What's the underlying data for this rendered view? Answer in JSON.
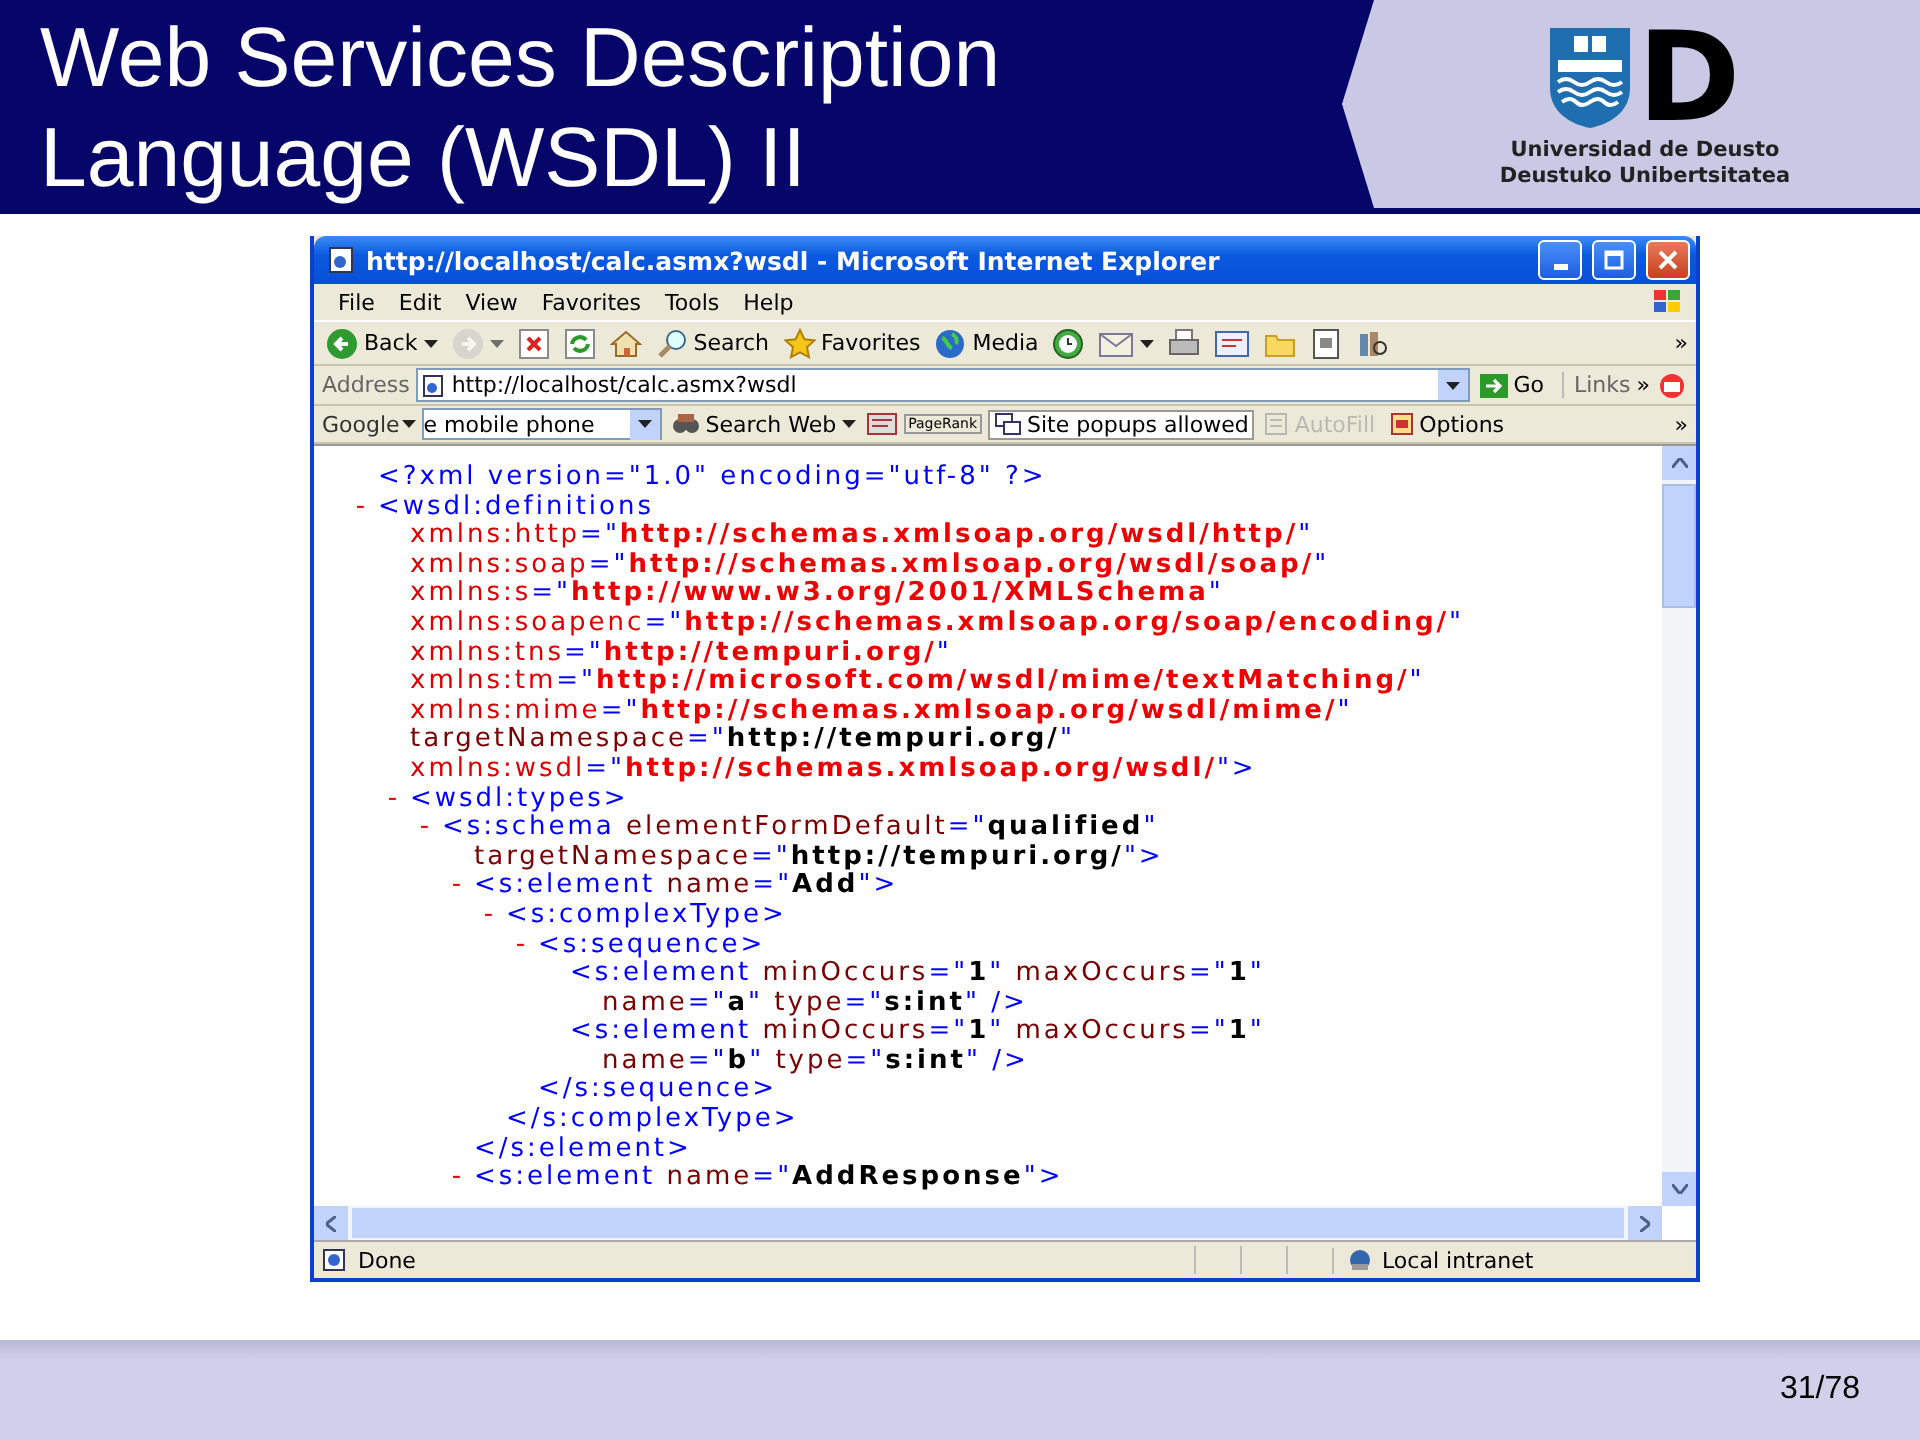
{
  "slide": {
    "title_lines": [
      "Web Services Description",
      "Language (WSDL) II"
    ],
    "logo": {
      "letter": "D",
      "name_lines": [
        "Universidad de Deusto",
        "Deustuko Unibertsitatea"
      ]
    },
    "page_number": "31/78"
  },
  "browser": {
    "title": "http://localhost/calc.asmx?wsdl - Microsoft Internet Explorer",
    "menu": [
      "File",
      "Edit",
      "View",
      "Favorites",
      "Tools",
      "Help"
    ],
    "toolbar": [
      {
        "label": "Back",
        "dropdown": true,
        "disabled": false
      },
      {
        "dropdown": true,
        "disabled": true
      },
      {
        "dropdown": false,
        "disabled": false
      },
      {
        "dropdown": false,
        "disabled": false
      },
      {
        "dropdown": false,
        "disabled": false
      },
      {
        "label": "Search",
        "dropdown": false,
        "disabled": false
      },
      {
        "label": "Favorites",
        "dropdown": false,
        "disabled": false
      },
      {
        "label": "Media",
        "dropdown": false,
        "disabled": false
      },
      {
        "dropdown": false,
        "disabled": false
      },
      {
        "dropdown": true,
        "disabled": false
      },
      {
        "dropdown": false,
        "disabled": false
      },
      {
        "dropdown": false,
        "disabled": false
      },
      {
        "dropdown": false,
        "disabled": false
      },
      {
        "dropdown": false,
        "disabled": false
      },
      {
        "dropdown": false,
        "disabled": false
      }
    ],
    "toolbar_more": "»",
    "address": {
      "label": "Address",
      "value": "http://localhost/calc.asmx?wsdl",
      "go": "Go",
      "links": "Links",
      "more": "»"
    },
    "google_bar": {
      "brand": "Google",
      "query": "e mobile phone",
      "search": "Search Web",
      "pagerank": "PageRank",
      "popups": "Site popups allowed",
      "autofill": {
        "label": "AutoFill",
        "disabled": true
      },
      "options": "Options",
      "more": "»"
    },
    "xml": [
      {
        "lines": [
          [
            {
              "kind": "tag",
              "text": "<?xml version=\"1.0\" encoding=\"utf-8\" ?>"
            }
          ]
        ]
      },
      {
        "toggle": "-",
        "lines": [
          [
            {
              "kind": "tag",
              "text": "<wsdl:definitions"
            }
          ],
          [
            {
              "kind": "ns_attr",
              "text": "xmlns:http"
            },
            {
              "kind": "tag",
              "text": "=\""
            },
            {
              "kind": "ns_value",
              "text": "http://schemas.xmlsoap.org/wsdl/http/"
            },
            {
              "kind": "tag",
              "text": "\""
            }
          ],
          [
            {
              "kind": "ns_attr",
              "text": "xmlns:soap"
            },
            {
              "kind": "tag",
              "text": "=\""
            },
            {
              "kind": "ns_value",
              "text": "http://schemas.xmlsoap.org/wsdl/soap/"
            },
            {
              "kind": "tag",
              "text": "\""
            }
          ],
          [
            {
              "kind": "ns_attr",
              "text": "xmlns:s"
            },
            {
              "kind": "tag",
              "text": "=\""
            },
            {
              "kind": "ns_value",
              "text": "http://www.w3.org/2001/XMLSchema"
            },
            {
              "kind": "tag",
              "text": "\""
            }
          ],
          [
            {
              "kind": "ns_attr",
              "text": "xmlns:soapenc"
            },
            {
              "kind": "tag",
              "text": "=\""
            },
            {
              "kind": "ns_value",
              "text": "http://schemas.xmlsoap.org/soap/encoding/"
            },
            {
              "kind": "tag",
              "text": "\""
            }
          ],
          [
            {
              "kind": "ns_attr",
              "text": "xmlns:tns"
            },
            {
              "kind": "tag",
              "text": "=\""
            },
            {
              "kind": "ns_value",
              "text": "http://tempuri.org/"
            },
            {
              "kind": "tag",
              "text": "\""
            }
          ],
          [
            {
              "kind": "ns_attr",
              "text": "xmlns:tm"
            },
            {
              "kind": "tag",
              "text": "=\""
            },
            {
              "kind": "ns_value",
              "text": "http://microsoft.com/wsdl/mime/textMatching/"
            },
            {
              "kind": "tag",
              "text": "\""
            }
          ],
          [
            {
              "kind": "ns_attr",
              "text": "xmlns:mime"
            },
            {
              "kind": "tag",
              "text": "=\""
            },
            {
              "kind": "ns_value",
              "text": "http://schemas.xmlsoap.org/wsdl/mime/"
            },
            {
              "kind": "tag",
              "text": "\""
            }
          ],
          [
            {
              "kind": "attr",
              "text": "targetNamespace"
            },
            {
              "kind": "tag",
              "text": "=\""
            },
            {
              "kind": "value",
              "text": "http://tempuri.org/"
            },
            {
              "kind": "tag",
              "text": "\""
            }
          ],
          [
            {
              "kind": "ns_attr",
              "text": "xmlns:wsdl"
            },
            {
              "kind": "tag",
              "text": "=\""
            },
            {
              "kind": "ns_value",
              "text": "http://schemas.xmlsoap.org/wsdl/"
            },
            {
              "kind": "tag",
              "text": "\">"
            }
          ]
        ],
        "children": [
          {
            "toggle": "-",
            "lines": [
              [
                {
                  "kind": "tag",
                  "text": "<wsdl:types>"
                }
              ]
            ],
            "children": [
              {
                "toggle": "-",
                "lines": [
                  [
                    {
                      "kind": "tag",
                      "text": "<s:schema "
                    },
                    {
                      "kind": "attr",
                      "text": "elementFormDefault"
                    },
                    {
                      "kind": "tag",
                      "text": "=\""
                    },
                    {
                      "kind": "value",
                      "text": "qualified"
                    },
                    {
                      "kind": "tag",
                      "text": "\""
                    }
                  ],
                  [
                    {
                      "kind": "attr",
                      "text": "targetNamespace"
                    },
                    {
                      "kind": "tag",
                      "text": "=\""
                    },
                    {
                      "kind": "value",
                      "text": "http://tempuri.org/"
                    },
                    {
                      "kind": "tag",
                      "text": "\">"
                    }
                  ]
                ],
                "children": [
                  {
                    "toggle": "-",
                    "lines": [
                      [
                        {
                          "kind": "tag",
                          "text": "<s:element "
                        },
                        {
                          "kind": "attr",
                          "text": "name"
                        },
                        {
                          "kind": "tag",
                          "text": "=\""
                        },
                        {
                          "kind": "value",
                          "text": "Add"
                        },
                        {
                          "kind": "tag",
                          "text": "\">"
                        }
                      ]
                    ],
                    "children": [
                      {
                        "toggle": "-",
                        "lines": [
                          [
                            {
                              "kind": "tag",
                              "text": "<s:complexType>"
                            }
                          ]
                        ],
                        "children": [
                          {
                            "toggle": "-",
                            "lines": [
                              [
                                {
                                  "kind": "tag",
                                  "text": "<s:sequence>"
                                }
                              ]
                            ],
                            "children": [
                              {
                                "lines": [
                                  [
                                    {
                                      "kind": "tag",
                                      "text": "<s:element "
                                    },
                                    {
                                      "kind": "attr",
                                      "text": "minOccurs"
                                    },
                                    {
                                      "kind": "tag",
                                      "text": "=\""
                                    },
                                    {
                                      "kind": "value",
                                      "text": "1"
                                    },
                                    {
                                      "kind": "tag",
                                      "text": "\" "
                                    },
                                    {
                                      "kind": "attr",
                                      "text": "maxOccurs"
                                    },
                                    {
                                      "kind": "tag",
                                      "text": "=\""
                                    },
                                    {
                                      "kind": "value",
                                      "text": "1"
                                    },
                                    {
                                      "kind": "tag",
                                      "text": "\""
                                    }
                                  ],
                                  [
                                    {
                                      "kind": "attr",
                                      "text": "name"
                                    },
                                    {
                                      "kind": "tag",
                                      "text": "=\""
                                    },
                                    {
                                      "kind": "value",
                                      "text": "a"
                                    },
                                    {
                                      "kind": "tag",
                                      "text": "\" "
                                    },
                                    {
                                      "kind": "attr",
                                      "text": "type"
                                    },
                                    {
                                      "kind": "tag",
                                      "text": "=\""
                                    },
                                    {
                                      "kind": "value",
                                      "text": "s:int"
                                    },
                                    {
                                      "kind": "tag",
                                      "text": "\" />"
                                    }
                                  ]
                                ]
                              },
                              {
                                "lines": [
                                  [
                                    {
                                      "kind": "tag",
                                      "text": "<s:element "
                                    },
                                    {
                                      "kind": "attr",
                                      "text": "minOccurs"
                                    },
                                    {
                                      "kind": "tag",
                                      "text": "=\""
                                    },
                                    {
                                      "kind": "value",
                                      "text": "1"
                                    },
                                    {
                                      "kind": "tag",
                                      "text": "\" "
                                    },
                                    {
                                      "kind": "attr",
                                      "text": "maxOccurs"
                                    },
                                    {
                                      "kind": "tag",
                                      "text": "=\""
                                    },
                                    {
                                      "kind": "value",
                                      "text": "1"
                                    },
                                    {
                                      "kind": "tag",
                                      "text": "\""
                                    }
                                  ],
                                  [
                                    {
                                      "kind": "attr",
                                      "text": "name"
                                    },
                                    {
                                      "kind": "tag",
                                      "text": "=\""
                                    },
                                    {
                                      "kind": "value",
                                      "text": "b"
                                    },
                                    {
                                      "kind": "tag",
                                      "text": "\" "
                                    },
                                    {
                                      "kind": "attr",
                                      "text": "type"
                                    },
                                    {
                                      "kind": "tag",
                                      "text": "=\""
                                    },
                                    {
                                      "kind": "value",
                                      "text": "s:int"
                                    },
                                    {
                                      "kind": "tag",
                                      "text": "\" />"
                                    }
                                  ]
                                ]
                              }
                            ],
                            "close": "</s:sequence>"
                          }
                        ],
                        "close": "</s:complexType>"
                      }
                    ],
                    "close": "</s:element>"
                  },
                  {
                    "toggle": "-",
                    "lines": [
                      [
                        {
                          "kind": "tag",
                          "text": "<s:element "
                        },
                        {
                          "kind": "attr",
                          "text": "name"
                        },
                        {
                          "kind": "tag",
                          "text": "=\""
                        },
                        {
                          "kind": "value",
                          "text": "AddResponse"
                        },
                        {
                          "kind": "tag",
                          "text": "\">"
                        }
                      ]
                    ]
                  }
                ]
              }
            ]
          }
        ]
      }
    ],
    "status": {
      "text": "Done",
      "zone": "Local intranet"
    }
  }
}
